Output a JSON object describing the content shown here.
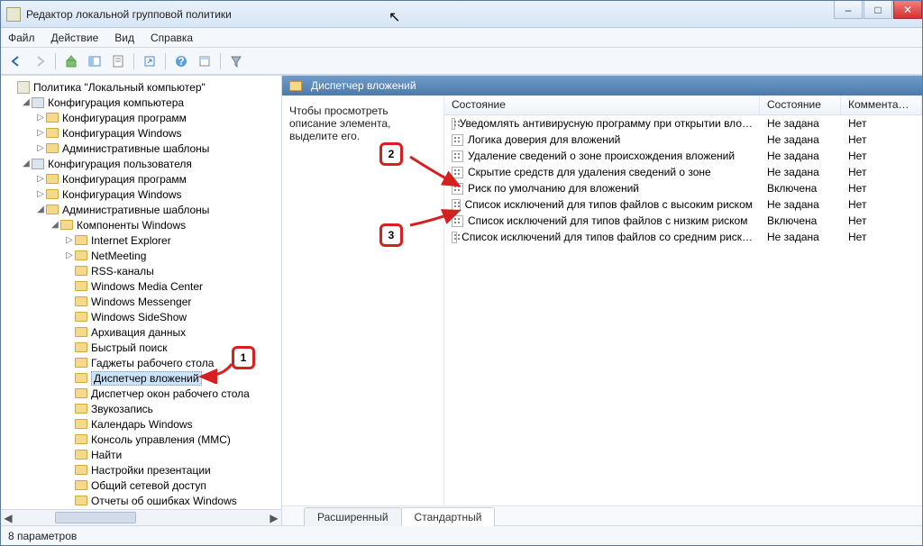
{
  "window": {
    "title": "Редактор локальной групповой политики"
  },
  "menu": {
    "file": "Файл",
    "action": "Действие",
    "view": "Вид",
    "help": "Справка"
  },
  "tree": {
    "root": "Политика \"Локальный компьютер\"",
    "comp_conf": "Конфигурация компьютера",
    "comp_children": [
      "Конфигурация программ",
      "Конфигурация Windows",
      "Административные шаблоны"
    ],
    "user_conf": "Конфигурация пользователя",
    "user_children": [
      "Конфигурация программ",
      "Конфигурация Windows"
    ],
    "admin_templates": "Административные шаблоны",
    "win_components": "Компоненты Windows",
    "components": [
      "Internet Explorer",
      "NetMeeting",
      "RSS-каналы",
      "Windows Media Center",
      "Windows Messenger",
      "Windows SideShow",
      "Архивация данных",
      "Быстрый поиск",
      "Гаджеты рабочего стола",
      "Диспетчер вложений",
      "Диспетчер окон рабочего стола",
      "Звукозапись",
      "Календарь Windows",
      "Консоль управления (MMC)",
      "Найти",
      "Настройки презентации",
      "Общий сетевой доступ",
      "Отчеты об ошибках Windows"
    ],
    "selected_index": 9
  },
  "right": {
    "header": "Диспетчер вложений",
    "desc": "Чтобы просмотреть описание элемента, выделите его.",
    "columns": {
      "state_head": "Состояние",
      "state": "Состояние",
      "comment": "Коммента…"
    },
    "rows": [
      {
        "name": "Уведомлять антивирусную программу при открытии вло…",
        "state": "Не задана",
        "comment": "Нет"
      },
      {
        "name": "Логика доверия для вложений",
        "state": "Не задана",
        "comment": "Нет"
      },
      {
        "name": "Удаление сведений о зоне происхождения вложений",
        "state": "Не задана",
        "comment": "Нет"
      },
      {
        "name": "Скрытие средств для удаления сведений о зоне",
        "state": "Не задана",
        "comment": "Нет"
      },
      {
        "name": "Риск по умолчанию для вложений",
        "state": "Включена",
        "comment": "Нет"
      },
      {
        "name": "Список исключений для типов файлов с высоким риском",
        "state": "Не задана",
        "comment": "Нет"
      },
      {
        "name": "Список исключений для типов файлов с низким риском",
        "state": "Включена",
        "comment": "Нет"
      },
      {
        "name": "Список исключений для типов файлов со средним риск…",
        "state": "Не задана",
        "comment": "Нет"
      }
    ]
  },
  "tabs": {
    "extended": "Расширенный",
    "standard": "Стандартный"
  },
  "status": {
    "text": "8 параметров"
  },
  "callouts": {
    "c1": "1",
    "c2": "2",
    "c3": "3"
  }
}
